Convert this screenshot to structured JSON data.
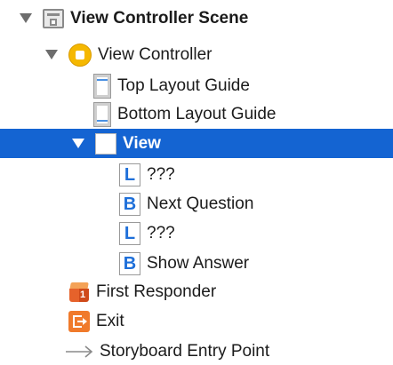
{
  "outline": {
    "scene": {
      "label": "View Controller Scene",
      "icon": "storyboard-scene-icon"
    },
    "view_controller": {
      "label": "View Controller",
      "icon": "view-controller-icon"
    },
    "top_layout_guide": {
      "label": "Top Layout Guide",
      "icon": "top-layout-guide-icon"
    },
    "bottom_layout_guide": {
      "label": "Bottom Layout Guide",
      "icon": "bottom-layout-guide-icon"
    },
    "view": {
      "label": "View",
      "icon": "view-icon",
      "selected": true
    },
    "subviews": [
      {
        "type_letter": "L",
        "label": "???",
        "icon": "label-icon"
      },
      {
        "type_letter": "B",
        "label": "Next Question",
        "icon": "button-icon"
      },
      {
        "type_letter": "L",
        "label": "???",
        "icon": "label-icon"
      },
      {
        "type_letter": "B",
        "label": "Show Answer",
        "icon": "button-icon"
      }
    ],
    "first_responder": {
      "label": "First Responder",
      "icon": "first-responder-icon",
      "badge": "1"
    },
    "exit": {
      "label": "Exit",
      "icon": "exit-icon"
    },
    "entry_point": {
      "label": "Storyboard Entry Point",
      "icon": "entry-point-arrow-icon"
    }
  },
  "colors": {
    "selection": "#1464d2",
    "letter_icon": "#1e6fd9",
    "view_controller_icon": "#f5b800",
    "exit_icon": "#f07a2b",
    "first_responder_icon": "#e6622b"
  }
}
